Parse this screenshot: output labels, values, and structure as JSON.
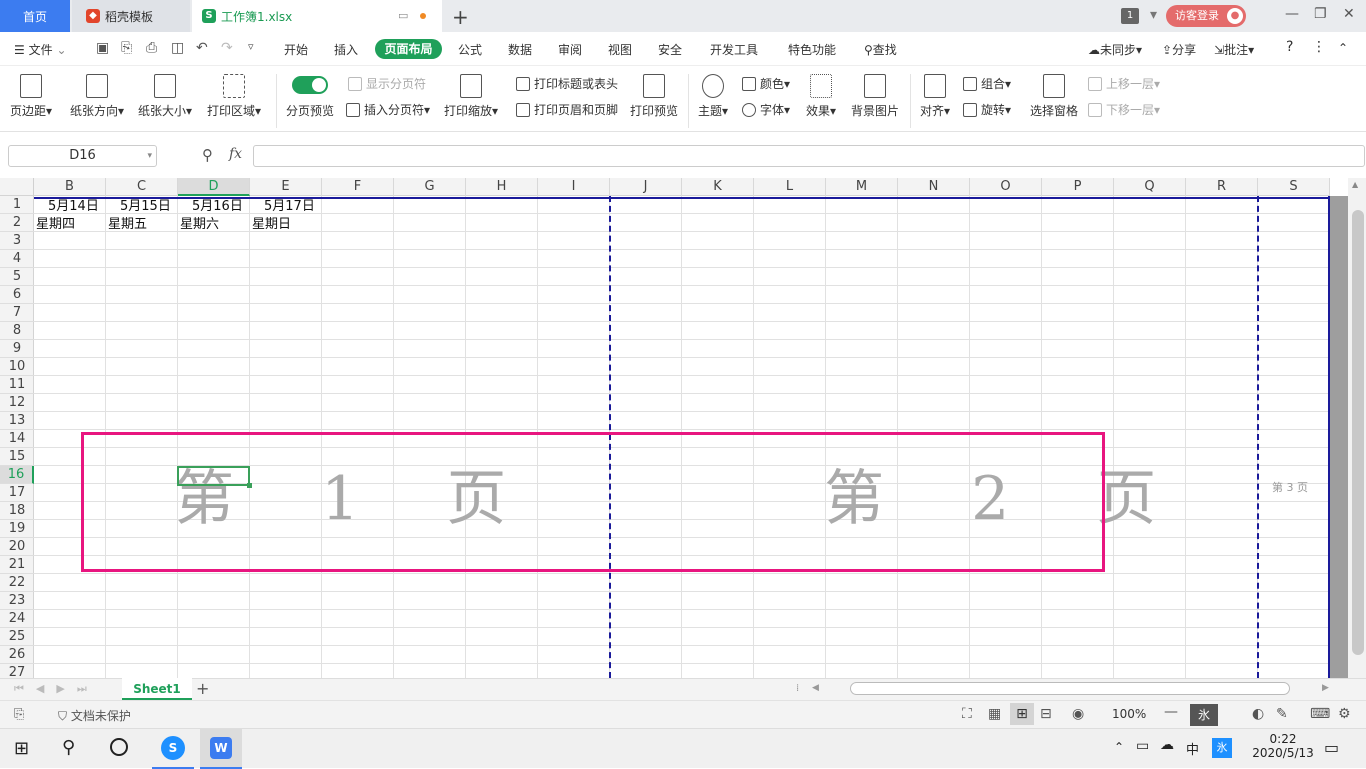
{
  "tabs": {
    "home": "首页",
    "daoke": "稻壳模板",
    "file": "工作簿1.xlsx"
  },
  "titlebar": {
    "badge": "1",
    "login": "访客登录"
  },
  "menu": {
    "file": "文件",
    "items": [
      "开始",
      "插入",
      "页面布局",
      "公式",
      "数据",
      "审阅",
      "视图",
      "安全",
      "开发工具",
      "特色功能"
    ],
    "search": "查找",
    "sync": "未同步",
    "share": "分享",
    "comment": "批注"
  },
  "ribbon": {
    "margins": "页边距",
    "orientation": "纸张方向",
    "size": "纸张大小",
    "print_area": "打印区域",
    "page_break_preview": "分页预览",
    "show_page_break": "显示分页符",
    "insert_page_break": "插入分页符",
    "print_scale": "打印缩放",
    "print_titles": "打印标题或表头",
    "print_header_footer": "打印页眉和页脚",
    "print_preview": "打印预览",
    "theme": "主题",
    "colors": "颜色",
    "fonts": "字体",
    "effects": "效果",
    "background": "背景图片",
    "align": "对齐",
    "group": "组合",
    "rotate": "旋转",
    "selection_pane": "选择窗格",
    "bring_forward": "上移一层",
    "send_backward": "下移一层"
  },
  "formula": {
    "namebox": "D16",
    "fx": "fx",
    "value": ""
  },
  "columns": [
    "B",
    "C",
    "D",
    "E",
    "F",
    "G",
    "H",
    "I",
    "J",
    "K",
    "L",
    "M",
    "N",
    "O",
    "P",
    "Q",
    "R",
    "S"
  ],
  "rows": [
    "1",
    "2",
    "3",
    "4",
    "5",
    "6",
    "7",
    "8",
    "9",
    "10",
    "11",
    "12",
    "13",
    "14",
    "15",
    "16",
    "17",
    "18",
    "19",
    "20",
    "21",
    "22",
    "23",
    "24",
    "25",
    "26",
    "27"
  ],
  "cells": {
    "r1": [
      "5月14日",
      "5月15日",
      "5月16日",
      "5月17日"
    ],
    "r2": [
      "星期四",
      "星期五",
      "星期六",
      "星期日"
    ]
  },
  "pages": {
    "p1": "第 1 页",
    "p2": "第 2 页",
    "p3": "第 3 页"
  },
  "sheet": {
    "name": "Sheet1"
  },
  "status": {
    "protect": "文档未保护",
    "zoom": "100%"
  },
  "taskbar": {
    "time": "0:22",
    "date": "2020/5/13",
    "ime": "中",
    "ime2": "氷"
  },
  "colors": {
    "accent": "#1fa05a",
    "highlight_box": "#e8157f",
    "page_break": "#1a1a9a"
  }
}
